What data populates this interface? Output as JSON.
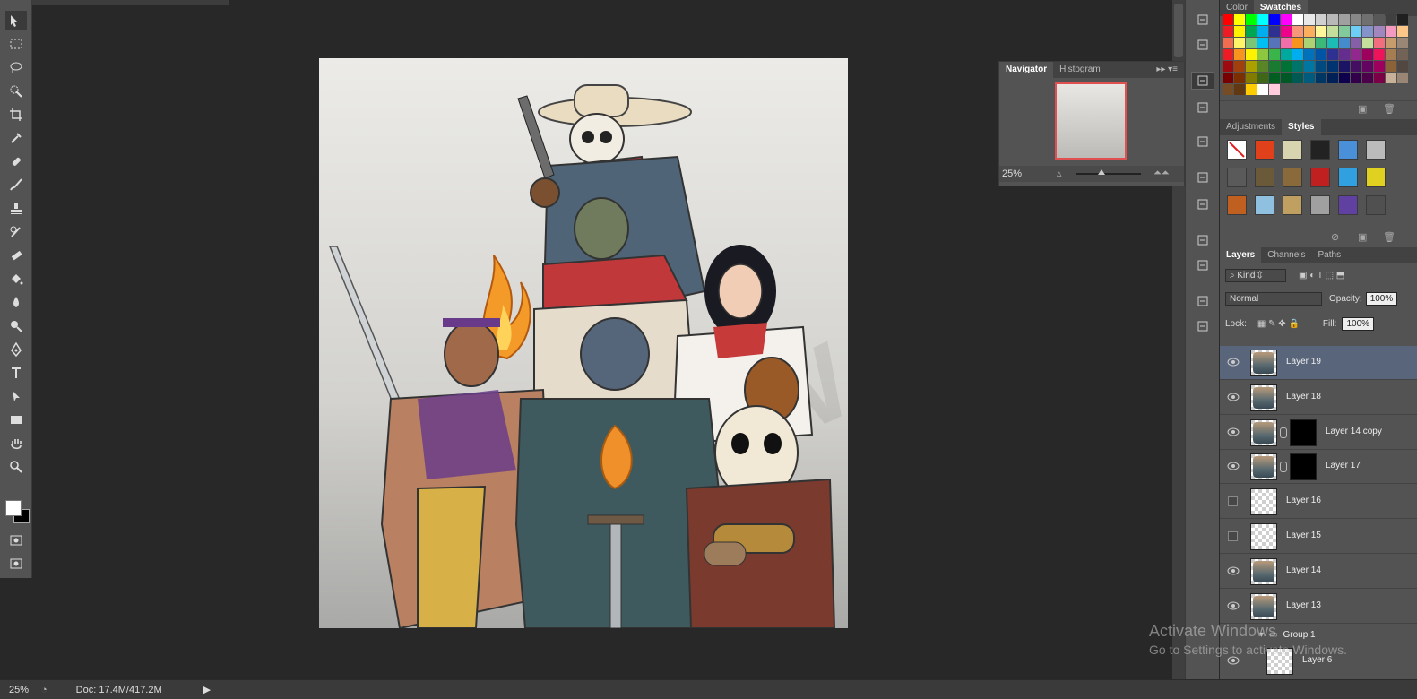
{
  "status": {
    "zoom": "25%",
    "doc": "Doc: 17.4M/417.2M"
  },
  "navigator": {
    "tabs": [
      "Navigator",
      "Histogram"
    ],
    "zoom": "25%"
  },
  "swatches_panel": {
    "tabs": [
      "Color",
      "Swatches"
    ],
    "active": "Swatches",
    "colors": [
      "#ff0000",
      "#ffff00",
      "#00ff00",
      "#00ffff",
      "#0000ff",
      "#ff00ff",
      "#ffffff",
      "#e8e8e8",
      "#d0d0d0",
      "#b8b8b8",
      "#a0a0a0",
      "#888888",
      "#707070",
      "#585858",
      "#404040",
      "#202020",
      "#ed1c24",
      "#fff200",
      "#00a651",
      "#00aeef",
      "#2e3192",
      "#ec008c",
      "#f7977a",
      "#fbaf5d",
      "#fff79a",
      "#c4df9b",
      "#82ca9c",
      "#6dcff6",
      "#8493ca",
      "#a187be",
      "#f49ac1",
      "#fdc689",
      "#f26c4f",
      "#fff568",
      "#7cc576",
      "#00bff3",
      "#5674b9",
      "#f06eaa",
      "#f7941d",
      "#acd373",
      "#3cb878",
      "#1cbbb4",
      "#448ccb",
      "#8560a8",
      "#c4df9b",
      "#f26d7d",
      "#c69c6d",
      "#998675",
      "#ed1c24",
      "#f7941d",
      "#fff200",
      "#8dc63f",
      "#39b54a",
      "#00a99d",
      "#00aeef",
      "#0072bc",
      "#0054a6",
      "#2e3192",
      "#662d91",
      "#92278f",
      "#9e005d",
      "#ed145b",
      "#a67c52",
      "#736357",
      "#9e0b0f",
      "#a0410d",
      "#aba000",
      "#598527",
      "#197b30",
      "#007236",
      "#00746b",
      "#0076a3",
      "#004a80",
      "#003471",
      "#1b1464",
      "#440e62",
      "#630460",
      "#9e005d",
      "#8c6239",
      "#534741",
      "#790000",
      "#7b2e00",
      "#827b00",
      "#406618",
      "#005e20",
      "#005826",
      "#005952",
      "#005b7f",
      "#003663",
      "#002157",
      "#0d004c",
      "#32004b",
      "#4b0049",
      "#7b0046",
      "#c7b299",
      "#998675",
      "#754c24",
      "#603913",
      "#ffcc00",
      "#ffffff",
      "#ffccdd"
    ]
  },
  "adjustments_panel": {
    "tabs": [
      "Adjustments",
      "Styles"
    ],
    "active": "Styles",
    "styles": [
      "none",
      "#e0401a",
      "#d8d4b0",
      "#222222",
      "#4a90d8",
      "#bbbbbb",
      "#5a5a5a",
      "#6a5a3a",
      "#8a6a3a",
      "#c02020",
      "#30a0e0",
      "#e0d020",
      "#c06020",
      "#90c0e0",
      "#c0a060",
      "#a0a0a0",
      "#6040a0",
      "#505050"
    ]
  },
  "layers_panel": {
    "tabs": [
      "Layers",
      "Channels",
      "Paths"
    ],
    "kind": "Kind",
    "blend_mode": "Normal",
    "opacity_label": "Opacity:",
    "opacity": "100%",
    "lock_label": "Lock:",
    "fill_label": "Fill:",
    "fill": "100%",
    "layers": [
      {
        "name": "Layer 19",
        "visible": true,
        "selected": true,
        "mask": false
      },
      {
        "name": "Layer 18",
        "visible": true,
        "selected": false,
        "mask": false
      },
      {
        "name": "Layer 14 copy",
        "visible": true,
        "selected": false,
        "mask": true
      },
      {
        "name": "Layer 17",
        "visible": true,
        "selected": false,
        "mask": true
      },
      {
        "name": "Layer 16",
        "visible": false,
        "selected": false,
        "mask": false
      },
      {
        "name": "Layer 15",
        "visible": false,
        "selected": false,
        "mask": false
      },
      {
        "name": "Layer 14",
        "visible": true,
        "selected": false,
        "mask": false
      },
      {
        "name": "Layer 13",
        "visible": true,
        "selected": false,
        "mask": false
      }
    ],
    "group": "Group 1",
    "group_child": "Layer 6"
  },
  "watermark": {
    "line1": "Activate Windows",
    "line2": "Go to Settings to activate Windows."
  },
  "tools": [
    "move-icon",
    "marquee-icon",
    "lasso-icon",
    "quick-select-icon",
    "crop-icon",
    "eyedropper-icon",
    "healing-icon",
    "brush-icon",
    "stamp-icon",
    "history-brush-icon",
    "eraser-icon",
    "paint-bucket-icon",
    "blur-icon",
    "dodge-icon",
    "pen-icon",
    "type-icon",
    "path-select-icon",
    "rectangle-icon",
    "hand-icon",
    "zoom-icon"
  ],
  "colors": {
    "foreground": "#ffffff",
    "background": "#000000",
    "selected_layer": "#59657a"
  }
}
